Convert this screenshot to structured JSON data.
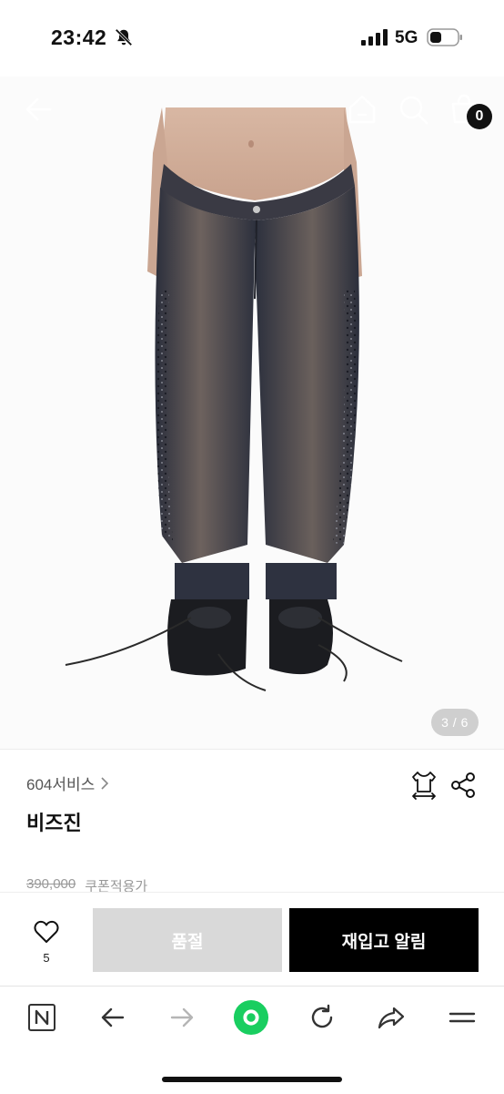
{
  "status_bar": {
    "time": "23:42",
    "network": "5G",
    "icons": [
      "bell-muted-icon",
      "signal-icon",
      "battery-icon"
    ]
  },
  "top_nav": {
    "icons": [
      "back-arrow-icon",
      "home-icon",
      "search-icon",
      "cart-icon"
    ],
    "cart_count": "0"
  },
  "gallery": {
    "page_indicator": "3 / 6",
    "current_image": 3,
    "total_images": 6
  },
  "product": {
    "brand": "604서비스",
    "title": "비즈진",
    "price_original": "390,000",
    "price_note": "쿠폰적용가"
  },
  "action_bar": {
    "like_count": "5",
    "soldout_label": "품절",
    "restock_label": "재입고 알림"
  },
  "browser_toolbar": {
    "icons": [
      "naver-n-icon",
      "back-icon",
      "forward-icon",
      "green-dot-icon",
      "reload-icon",
      "share-arrow-icon",
      "menu-icon"
    ]
  },
  "colors": {
    "accent_green": "#19ce60",
    "soldout_gray": "#d9d9d9",
    "restock_black": "#000000"
  }
}
